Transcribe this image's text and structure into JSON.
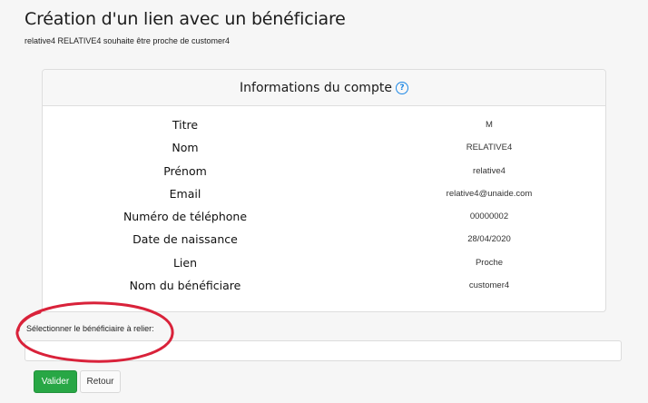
{
  "page": {
    "title": "Création d'un lien avec un bénéficiare",
    "subtitle": "relative4 RELATIVE4 souhaite être proche de customer4"
  },
  "card": {
    "title": "Informations du compte",
    "help_icon_glyph": "?",
    "rows": [
      {
        "label": "Titre",
        "value": "M"
      },
      {
        "label": "Nom",
        "value": "RELATIVE4"
      },
      {
        "label": "Prénom",
        "value": "relative4"
      },
      {
        "label": "Email",
        "value": "relative4@unaide.com"
      },
      {
        "label": "Numéro de téléphone",
        "value": "00000002"
      },
      {
        "label": "Date de naissance",
        "value": "28/04/2020"
      },
      {
        "label": "Lien",
        "value": "Proche"
      },
      {
        "label": "Nom du bénéficiare",
        "value": "customer4"
      }
    ]
  },
  "form": {
    "select_label": "Sélectionner le bénéficiaire à relier:",
    "select_value": ""
  },
  "buttons": {
    "validate_label": "Valider",
    "back_label": "Retour"
  },
  "colors": {
    "validate_button": "#28a745",
    "help_icon": "#1e88e5",
    "annotation": "#d9223a"
  }
}
